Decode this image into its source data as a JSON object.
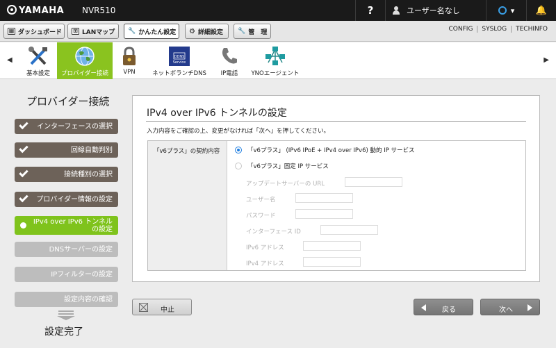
{
  "header": {
    "brand": "YAMAHA",
    "model": "NVR510",
    "help": "?",
    "user": "ユーザー名なし",
    "status_caret": "▾",
    "bell": "🔔"
  },
  "nav": {
    "tabs": [
      {
        "label": "ダッシュボード",
        "icon": "dashboard-icon",
        "glyph": "▦"
      },
      {
        "label": "LANマップ",
        "icon": "lan-map-icon",
        "glyph": "⊞"
      },
      {
        "label": "かんたん設定",
        "icon": "wrench-icon",
        "glyph": "🔧"
      },
      {
        "label": "詳細設定",
        "icon": "gear-icon",
        "glyph": "⚙"
      },
      {
        "label": "管　理",
        "icon": "tools-icon",
        "glyph": "🔧"
      }
    ],
    "links": [
      "CONFIG",
      "SYSLOG",
      "TECHINFO"
    ]
  },
  "icon_menu": {
    "left_arrow": "◀",
    "right_arrow": "▶",
    "items": [
      {
        "label": "基本設定",
        "icon": "tools-icon"
      },
      {
        "label": "プロバイダー接続",
        "icon": "globe-icon"
      },
      {
        "label": "VPN",
        "icon": "lock-icon"
      },
      {
        "label": "ネットボランチDNS",
        "icon": "dns-service-icon",
        "badge_lines": [
          "DDNS",
          "Service"
        ]
      },
      {
        "label": "IP電話",
        "icon": "phone-icon"
      },
      {
        "label": "YNOエージェント",
        "icon": "network-icon"
      }
    ]
  },
  "steps": {
    "title": "プロバイダー接続",
    "items": [
      {
        "label": "インターフェースの選択",
        "state": "done"
      },
      {
        "label": "回線自動判別",
        "state": "done"
      },
      {
        "label": "接続種別の選択",
        "state": "done"
      },
      {
        "label": "プロバイダー情報の設定",
        "state": "done"
      },
      {
        "label_line1": "IPv4 over IPv6 トンネル",
        "label_line2": "の設定",
        "state": "current"
      },
      {
        "label": "DNSサーバーの設定",
        "state": "todo"
      },
      {
        "label": "IPフィルターの設定",
        "state": "todo"
      },
      {
        "label": "設定内容の確認",
        "state": "todo"
      }
    ],
    "final": "設定完了"
  },
  "panel": {
    "title": "IPv4 over IPv6 トンネルの設定",
    "description": "入力内容をご確認の上、変更がなければ「次へ」を押してください。",
    "field_label": "「v6プラス」の契約内容",
    "options": [
      {
        "label": "「v6プラス」 (IPv6 IPoE + IPv4 over IPv6) 動的 IP サービス",
        "selected": true
      },
      {
        "label": "「v6プラス」固定 IP サービス",
        "selected": false
      }
    ],
    "sub_fields": [
      {
        "label": "アップデートサーバーの URL",
        "value": ""
      },
      {
        "label": "ユーザー名",
        "value": ""
      },
      {
        "label": "パスワード",
        "value": ""
      },
      {
        "label": "インターフェース ID",
        "value": ""
      },
      {
        "label": "IPv6 アドレス",
        "value": ""
      },
      {
        "label": "IPv4 アドレス",
        "value": ""
      }
    ]
  },
  "buttons": {
    "cancel": "中止",
    "back": "戻る",
    "next": "次へ"
  },
  "colors": {
    "accent_green": "#8ac31f",
    "step_done": "#6d6259",
    "step_todo": "#bdbdbd",
    "radio_blue": "#1f7ee0",
    "topbar": "#1a1a1a"
  }
}
